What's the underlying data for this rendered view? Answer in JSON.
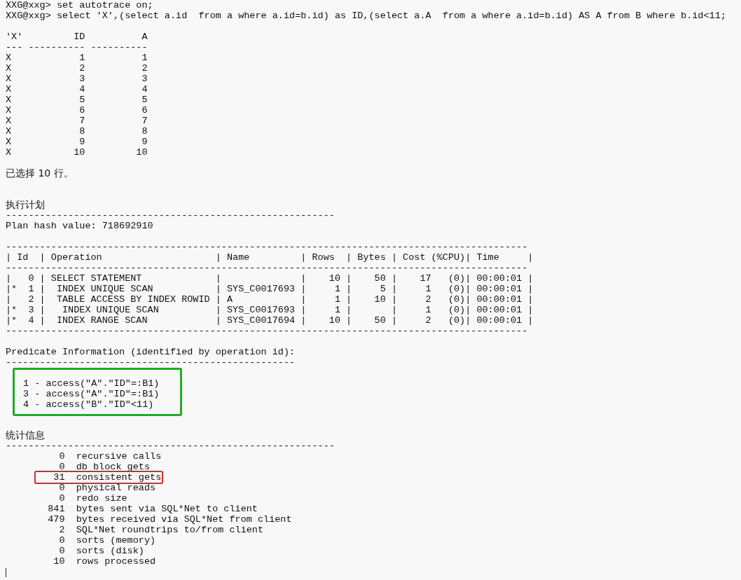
{
  "session": {
    "commands": [
      "XXG@xxg> set autotrace on;",
      "XXG@xxg> select 'X',(select a.id  from a where a.id=b.id) as ID,(select a.A  from a where a.id=b.id) AS A from B where b.id<11;"
    ],
    "result": {
      "columns": [
        "'X'",
        "ID",
        "A"
      ],
      "rule": "--- ---------- ----------",
      "rows": [
        [
          "X",
          "1",
          "1"
        ],
        [
          "X",
          "2",
          "2"
        ],
        [
          "X",
          "3",
          "3"
        ],
        [
          "X",
          "4",
          "4"
        ],
        [
          "X",
          "5",
          "5"
        ],
        [
          "X",
          "6",
          "6"
        ],
        [
          "X",
          "7",
          "7"
        ],
        [
          "X",
          "8",
          "8"
        ],
        [
          "X",
          "9",
          "9"
        ],
        [
          "X",
          "10",
          "10"
        ]
      ]
    },
    "row_count": "已选择 10 行。",
    "plan": {
      "title": "执行计划",
      "rule": "----------------------------------------------------------",
      "hash": "Plan hash value: 718692910",
      "table_rule": "--------------------------------------------------------------------------------------------",
      "header": "| Id  | Operation                    | Name         | Rows  | Bytes | Cost (%CPU)| Time     |",
      "rows": [
        "|   0 | SELECT STATEMENT             |              |    10 |    50 |    17   (0)| 00:00:01 |",
        "|*  1 |  INDEX UNIQUE SCAN           | SYS_C0017693 |     1 |     5 |     1   (0)| 00:00:01 |",
        "|   2 |  TABLE ACCESS BY INDEX ROWID | A            |     1 |    10 |     2   (0)| 00:00:01 |",
        "|*  3 |   INDEX UNIQUE SCAN          | SYS_C0017693 |     1 |       |     1   (0)| 00:00:01 |",
        "|*  4 |  INDEX RANGE SCAN            | SYS_C0017694 |    10 |    50 |     2   (0)| 00:00:01 |"
      ]
    },
    "predicates": {
      "title": "Predicate Information (identified by operation id):",
      "rule": "---------------------------------------------------",
      "highlighted": true,
      "lines": [
        "1 - access(\"A\".\"ID\"=:B1)",
        "3 - access(\"A\".\"ID\"=:B1)",
        "4 - access(\"B\".\"ID\"<11)"
      ]
    },
    "statistics": {
      "title": "统计信息",
      "rule": "----------------------------------------------------------",
      "items": [
        {
          "value": "0",
          "label": "recursive calls",
          "highlighted": false
        },
        {
          "value": "0",
          "label": "db block gets",
          "highlighted": false
        },
        {
          "value": "31",
          "label": "consistent gets",
          "highlighted": true
        },
        {
          "value": "0",
          "label": "physical reads",
          "highlighted": false
        },
        {
          "value": "0",
          "label": "redo size",
          "highlighted": false
        },
        {
          "value": "841",
          "label": "bytes sent via SQL*Net to client",
          "highlighted": false
        },
        {
          "value": "479",
          "label": "bytes received via SQL*Net from client",
          "highlighted": false
        },
        {
          "value": "2",
          "label": "SQL*Net roundtrips to/from client",
          "highlighted": false
        },
        {
          "value": "0",
          "label": "sorts (memory)",
          "highlighted": false
        },
        {
          "value": "0",
          "label": "sorts (disk)",
          "highlighted": false
        },
        {
          "value": "10",
          "label": "rows processed",
          "highlighted": false
        }
      ]
    }
  }
}
